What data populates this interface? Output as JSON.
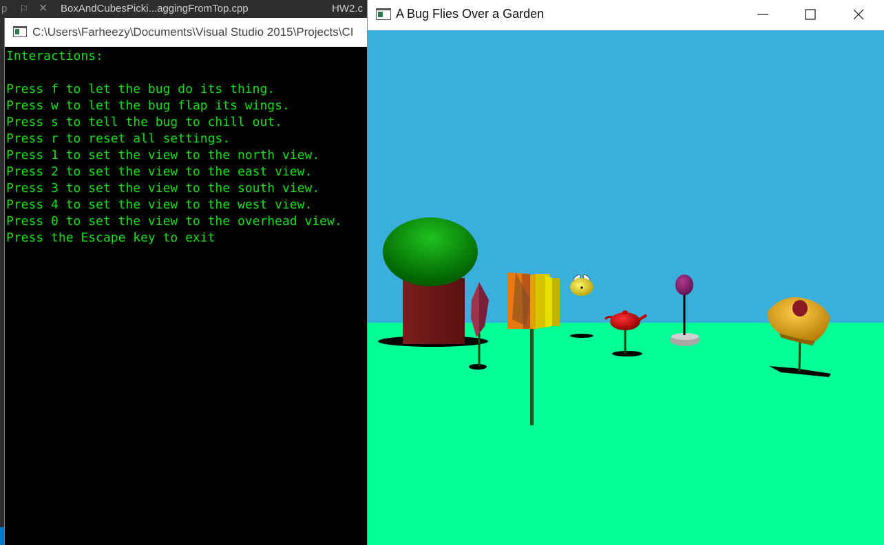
{
  "ide": {
    "tabs": [
      {
        "label": "p"
      },
      {
        "label": "BoxAndCubesPicki...aggingFromTop.cpp"
      },
      {
        "label": "HW2.c"
      }
    ]
  },
  "console_window": {
    "title": "C:\\Users\\Farheezy\\Documents\\Visual Studio 2015\\Projects\\CI",
    "lines": [
      "Interactions:",
      "",
      "Press f to let the bug do its thing.",
      "Press w to let the bug flap its wings.",
      "Press s to tell the bug to chill out.",
      "Press r to reset all settings.",
      "Press 1 to set the view to the north view.",
      "Press 2 to set the view to the east view.",
      "Press 3 to set the view to the south view.",
      "Press 4 to set the view to the west view.",
      "Press 0 to set the view to the overhead view.",
      "Press the Escape key to exit"
    ]
  },
  "gl_window": {
    "title": "A Bug Flies Over a Garden",
    "controls": {
      "minimize": "minimize-icon",
      "maximize": "maximize-icon",
      "close": "close-icon"
    }
  },
  "colors": {
    "sky": "#3bafdc",
    "ground": "#00ff95",
    "console_text": "#13e013",
    "console_bg": "#000000"
  }
}
